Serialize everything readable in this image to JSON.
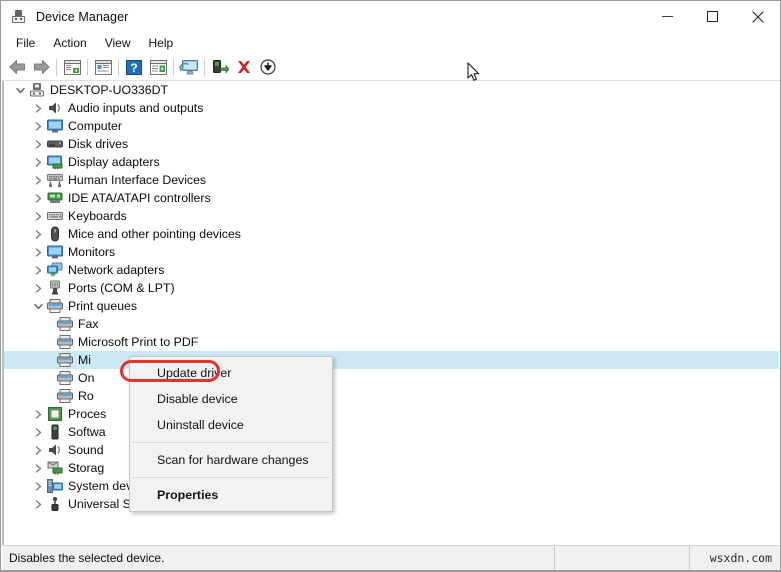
{
  "window": {
    "title": "Device Manager",
    "icon": "device-manager-icon",
    "controls": [
      {
        "name": "minimize-button",
        "glyph": "minimize"
      },
      {
        "name": "maximize-button",
        "glyph": "maximize"
      },
      {
        "name": "close-button",
        "glyph": "close"
      }
    ]
  },
  "menubar": {
    "items": [
      {
        "label": "File"
      },
      {
        "label": "Action"
      },
      {
        "label": "View"
      },
      {
        "label": "Help"
      }
    ]
  },
  "toolbar": {
    "buttons": [
      {
        "name": "back-button",
        "icon": "back-arrow-icon"
      },
      {
        "name": "forward-button",
        "icon": "forward-arrow-icon"
      },
      {
        "name": "show-hide-console-tree-button",
        "icon": "console-tree-icon"
      },
      {
        "name": "properties-button",
        "icon": "properties-window-icon"
      },
      {
        "name": "help-button",
        "icon": "help-question-icon"
      },
      {
        "name": "scan-for-hardware-changes-button",
        "icon": "scan-hardware-icon"
      },
      {
        "name": "update-driver-button",
        "icon": "update-driver-monitor-icon"
      },
      {
        "name": "disable-device-button",
        "icon": "disable-device-icon"
      },
      {
        "name": "uninstall-device-button",
        "icon": "uninstall-red-x-icon"
      },
      {
        "name": "add-legacy-hardware-button",
        "icon": "download-circle-icon"
      }
    ]
  },
  "tree": {
    "root": {
      "label": "DESKTOP-UO336DT",
      "icon": "computer-root-icon",
      "expanded": true
    },
    "nodes": [
      {
        "label": "Audio inputs and outputs",
        "icon": "speaker-icon",
        "expanded": false
      },
      {
        "label": "Computer",
        "icon": "monitor-icon",
        "expanded": false
      },
      {
        "label": "Disk drives",
        "icon": "disk-drive-icon",
        "expanded": false
      },
      {
        "label": "Display adapters",
        "icon": "display-adapter-icon",
        "expanded": false
      },
      {
        "label": "Human Interface Devices",
        "icon": "hid-icon",
        "expanded": false
      },
      {
        "label": "IDE ATA/ATAPI controllers",
        "icon": "ide-controller-icon",
        "expanded": false
      },
      {
        "label": "Keyboards",
        "icon": "keyboard-icon",
        "expanded": false
      },
      {
        "label": "Mice and other pointing devices",
        "icon": "mouse-icon",
        "expanded": false
      },
      {
        "label": "Monitors",
        "icon": "monitor-icon",
        "expanded": false
      },
      {
        "label": "Network adapters",
        "icon": "network-adapter-icon",
        "expanded": false
      },
      {
        "label": "Ports (COM & LPT)",
        "icon": "port-icon",
        "expanded": false
      },
      {
        "label": "Print queues",
        "icon": "printer-icon",
        "expanded": true
      },
      {
        "label": "Fax",
        "icon": "printer-icon",
        "child": true
      },
      {
        "label": "Microsoft Print to PDF",
        "icon": "printer-icon",
        "child": true
      },
      {
        "label": "Mi",
        "icon": "printer-icon",
        "child": true,
        "selected": true
      },
      {
        "label": "On",
        "icon": "printer-icon",
        "child": true
      },
      {
        "label": "Ro",
        "icon": "printer-icon",
        "child": true
      },
      {
        "label": "Proces",
        "icon": "processor-icon",
        "expanded": false
      },
      {
        "label": "Softwa",
        "icon": "software-device-icon",
        "expanded": false
      },
      {
        "label": "Sound",
        "icon": "speaker-icon",
        "expanded": false
      },
      {
        "label": "Storag",
        "icon": "storage-controller-icon",
        "expanded": false
      },
      {
        "label": "System devices",
        "icon": "system-device-icon",
        "expanded": false
      },
      {
        "label": "Universal Serial Bus controllers",
        "icon": "usb-icon",
        "expanded": false
      }
    ]
  },
  "context_menu": {
    "items": [
      {
        "label": "Update driver",
        "highlighted": true,
        "bold": false
      },
      {
        "label": "Disable device",
        "highlighted": false,
        "bold": false
      },
      {
        "label": "Uninstall device",
        "highlighted": false,
        "bold": false
      },
      {
        "separator": true
      },
      {
        "label": "Scan for hardware changes",
        "highlighted": false,
        "bold": false
      },
      {
        "separator": true
      },
      {
        "label": "Properties",
        "highlighted": false,
        "bold": true
      }
    ],
    "highlight_color": "#e8312b"
  },
  "statusbar": {
    "message": "Disables the selected device.",
    "watermark": "wsxdn.com"
  },
  "colors": {
    "selection": "#cce8f4",
    "menu_bg": "#f2f2f2",
    "status_bg": "#f0f0f0",
    "annotation": "#e8312b"
  }
}
